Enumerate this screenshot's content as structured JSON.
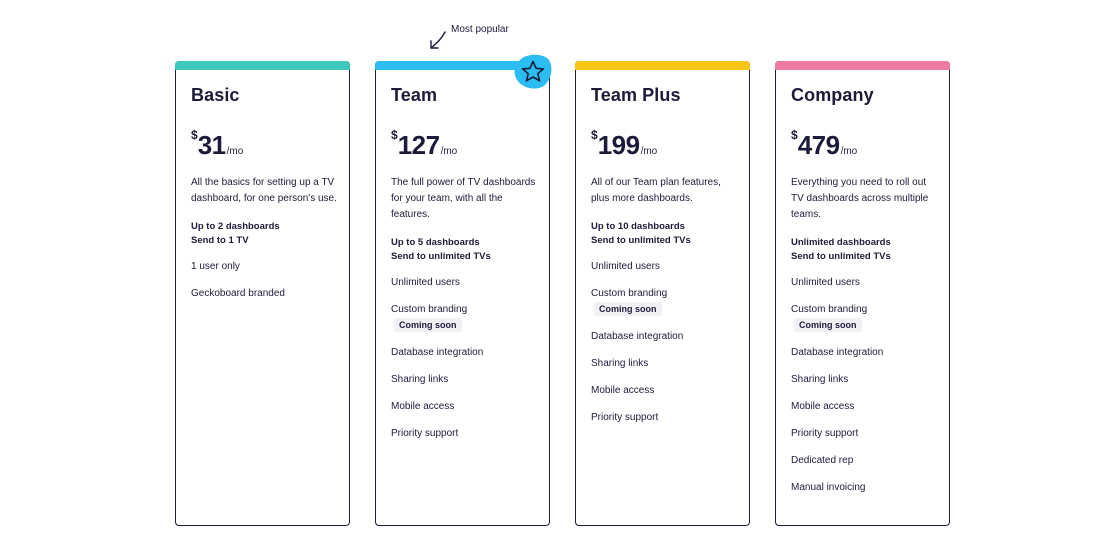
{
  "popular_note": {
    "text": "Most popular"
  },
  "plans": [
    {
      "name": "Basic",
      "currency": "$",
      "amount": "31",
      "period": "/mo",
      "accent": "#3cc8bd",
      "description": "All the basics for setting up a TV dashboard, for one person's use.",
      "limits": [
        "Up to 2 dashboards",
        "Send to 1 TV"
      ],
      "features": [
        {
          "label": "1 user only"
        },
        {
          "label": "Geckoboard branded"
        }
      ]
    },
    {
      "name": "Team",
      "currency": "$",
      "amount": "127",
      "period": "/mo",
      "accent": "#2bbcf2",
      "badge_icon": "star-icon",
      "description": "The full power of TV dashboards for your team, with all the features.",
      "limits": [
        "Up to 5 dashboards",
        "Send to unlimited TVs"
      ],
      "features": [
        {
          "label": "Unlimited users"
        },
        {
          "label": "Custom branding",
          "badge": "Coming soon"
        },
        {
          "label": "Database integration"
        },
        {
          "label": "Sharing links"
        },
        {
          "label": "Mobile access"
        },
        {
          "label": "Priority support"
        }
      ]
    },
    {
      "name": "Team Plus",
      "currency": "$",
      "amount": "199",
      "period": "/mo",
      "accent": "#f6c515",
      "description": "All of our Team plan features, plus more dashboards.",
      "limits": [
        "Up to 10 dashboards",
        "Send to unlimited TVs"
      ],
      "features": [
        {
          "label": "Unlimited users"
        },
        {
          "label": "Custom branding",
          "badge": "Coming soon"
        },
        {
          "label": "Database integration"
        },
        {
          "label": "Sharing links"
        },
        {
          "label": "Mobile access"
        },
        {
          "label": "Priority support"
        }
      ]
    },
    {
      "name": "Company",
      "currency": "$",
      "amount": "479",
      "period": "/mo",
      "accent": "#ef7aa0",
      "description": "Everything you need to roll out TV dashboards across multiple teams.",
      "limits": [
        "Unlimited dashboards",
        "Send to unlimited TVs"
      ],
      "features": [
        {
          "label": "Unlimited users"
        },
        {
          "label": "Custom branding",
          "badge": "Coming soon"
        },
        {
          "label": "Database integration"
        },
        {
          "label": "Sharing links"
        },
        {
          "label": "Mobile access"
        },
        {
          "label": "Priority support"
        },
        {
          "label": "Dedicated rep"
        },
        {
          "label": "Manual invoicing"
        }
      ]
    }
  ]
}
